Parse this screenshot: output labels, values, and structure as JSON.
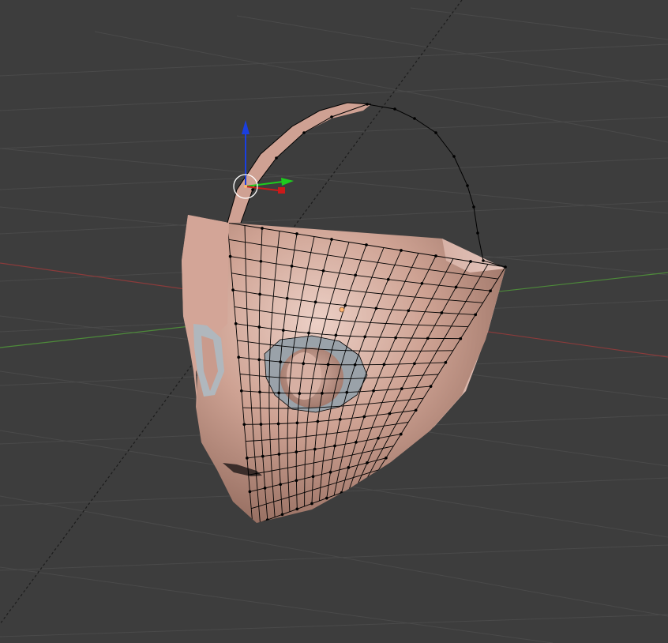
{
  "viewport": {
    "background_color": "#3d3d3d",
    "grid_color": "#4b4b4b",
    "x_axis_color": "#8a3b3b",
    "y_axis_color": "#4d8a3a",
    "dashed_line_color": "#1e1e1e"
  },
  "gizmo": {
    "x_axis_color": "#cc1a1a",
    "y_axis_color": "#1ecc1e",
    "z_axis_color": "#1a3fe0",
    "pivot_color": "#ffffff"
  },
  "mesh": {
    "skin_color": "#c89b8c",
    "skin_highlight": "#e8c7bb",
    "skin_shadow": "#8d6659",
    "wire_color": "#000000",
    "eye_ring_color": "#aeb6bd",
    "origin_dot_color": "#ffb46e"
  }
}
